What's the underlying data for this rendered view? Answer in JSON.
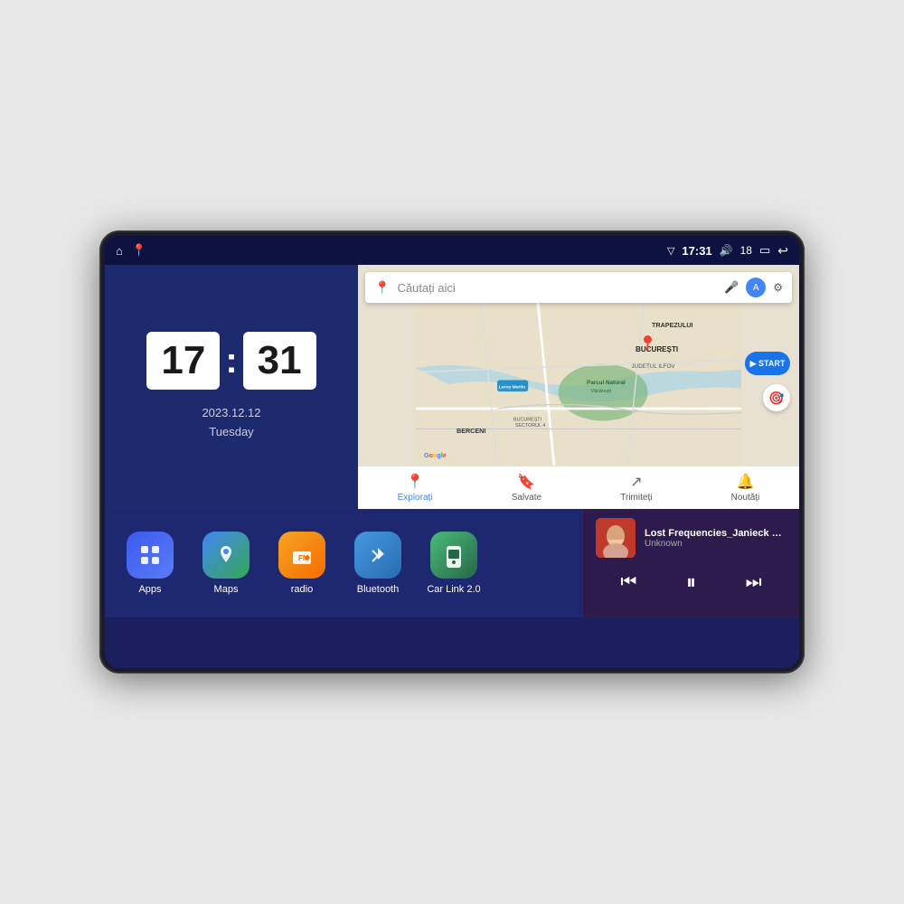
{
  "device": {
    "screen_bg": "#1a1f5e"
  },
  "status_bar": {
    "left_icons": [
      "home",
      "maps-pin"
    ],
    "time": "17:31",
    "volume_icon": "volume",
    "volume_level": "18",
    "battery_icon": "battery",
    "back_icon": "back"
  },
  "clock": {
    "hours": "17",
    "minutes": "31",
    "date": "2023.12.12",
    "day": "Tuesday"
  },
  "map": {
    "search_placeholder": "Căutați aici",
    "labels": [
      "TRAPEZULUI",
      "BUCUREȘTI",
      "JUDEȚUL ILFOV",
      "BERCENI",
      "Parcul Natural Văcărești",
      "Leroy Merlin",
      "BUCUREȘTI SECTORUL 4"
    ],
    "nav_items": [
      {
        "label": "Explorați",
        "icon": "📍",
        "active": true
      },
      {
        "label": "Salvate",
        "icon": "🔖",
        "active": false
      },
      {
        "label": "Trimiteți",
        "icon": "🔄",
        "active": false
      },
      {
        "label": "Noutăți",
        "icon": "🔔",
        "active": false
      }
    ]
  },
  "apps": [
    {
      "id": "apps",
      "label": "Apps",
      "icon_class": "icon-apps",
      "icon_symbol": "⊞"
    },
    {
      "id": "maps",
      "label": "Maps",
      "icon_class": "icon-maps",
      "icon_symbol": "📍"
    },
    {
      "id": "radio",
      "label": "radio",
      "icon_class": "icon-radio",
      "icon_symbol": "📻"
    },
    {
      "id": "bluetooth",
      "label": "Bluetooth",
      "icon_class": "icon-bluetooth",
      "icon_symbol": "🔷"
    },
    {
      "id": "carlink",
      "label": "Car Link 2.0",
      "icon_class": "icon-carlink",
      "icon_symbol": "📱"
    }
  ],
  "music": {
    "title": "Lost Frequencies_Janieck Devy-...",
    "artist": "Unknown",
    "prev_label": "⏮",
    "play_pause_label": "⏸",
    "next_label": "⏭"
  }
}
